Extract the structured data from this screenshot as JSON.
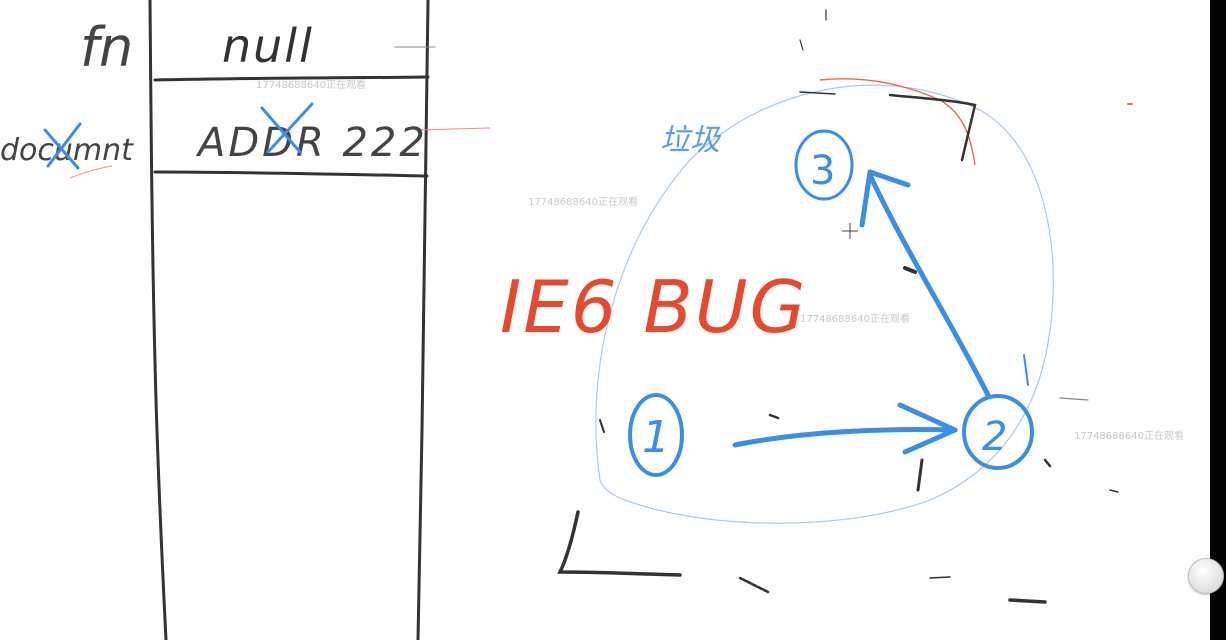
{
  "stack_table": {
    "row_labels": [
      "fn",
      "documnt"
    ],
    "cells": [
      "null",
      "ADDR 222"
    ]
  },
  "diagram": {
    "nodes": [
      "1",
      "2",
      "3"
    ],
    "chinese_note": "垃圾",
    "bug_label": "IE6 BUG"
  },
  "watermarks": [
    "17748688640正在观看",
    "17748688640正在观看",
    "17748688640正在观看",
    "17748688640正在观看"
  ],
  "colors": {
    "ink_black": "#333333",
    "ink_blue": "#3a8ee6",
    "ink_red": "#e8482e",
    "light_circle": "#a9c9ef"
  }
}
